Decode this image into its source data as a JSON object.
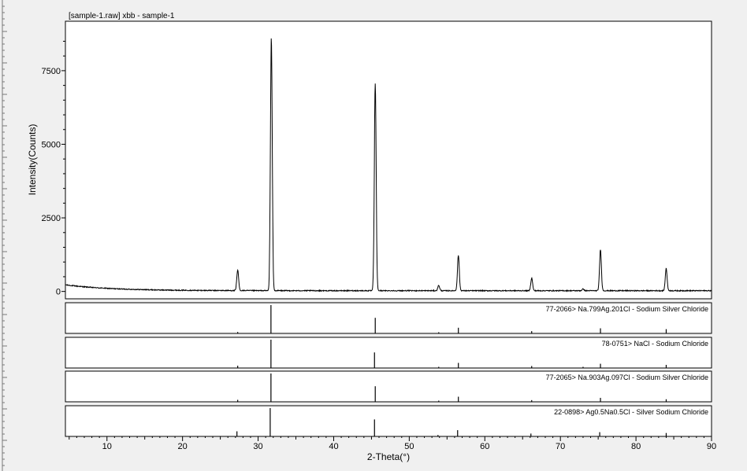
{
  "chart_data": {
    "type": "line",
    "title": "[sample-1.raw] xbb - sample-1",
    "xlabel": "2-Theta(°)",
    "ylabel": "Intensity(Counts)",
    "xlim": [
      4.5,
      90
    ],
    "ylim": [
      -250,
      9180
    ],
    "x_ticks": [
      10,
      20,
      30,
      40,
      50,
      60,
      70,
      80,
      90
    ],
    "y_ticks": [
      0,
      2500,
      5000,
      7500
    ],
    "grid": false,
    "background": 200,
    "peaks": [
      {
        "x": 27.3,
        "y": 700
      },
      {
        "x": 31.75,
        "y": 8600
      },
      {
        "x": 45.5,
        "y": 7050
      },
      {
        "x": 53.9,
        "y": 180
      },
      {
        "x": 56.5,
        "y": 1200
      },
      {
        "x": 66.2,
        "y": 430
      },
      {
        "x": 73.0,
        "y": 60
      },
      {
        "x": 75.3,
        "y": 1400
      },
      {
        "x": 84.0,
        "y": 760
      }
    ],
    "reference_patterns": [
      {
        "label": "77-2066> Na.799Ag.201Cl - Sodium Silver Chloride",
        "lines": [
          {
            "x": 27.3,
            "rel": 0.05
          },
          {
            "x": 31.7,
            "rel": 1.0
          },
          {
            "x": 45.5,
            "rel": 0.55
          },
          {
            "x": 53.9,
            "rel": 0.02
          },
          {
            "x": 56.5,
            "rel": 0.2
          },
          {
            "x": 66.2,
            "rel": 0.08
          },
          {
            "x": 75.3,
            "rel": 0.18
          },
          {
            "x": 84.0,
            "rel": 0.15
          }
        ]
      },
      {
        "label": "78-0751> NaCl - Sodium Chloride",
        "lines": [
          {
            "x": 27.3,
            "rel": 0.08
          },
          {
            "x": 31.7,
            "rel": 1.0
          },
          {
            "x": 45.4,
            "rel": 0.55
          },
          {
            "x": 53.9,
            "rel": 0.03
          },
          {
            "x": 56.5,
            "rel": 0.18
          },
          {
            "x": 66.2,
            "rel": 0.07
          },
          {
            "x": 73.0,
            "rel": 0.02
          },
          {
            "x": 75.3,
            "rel": 0.15
          },
          {
            "x": 84.0,
            "rel": 0.11
          }
        ]
      },
      {
        "label": "77-2065> Na.903Ag.097Cl - Sodium Silver Chloride",
        "lines": [
          {
            "x": 27.3,
            "rel": 0.07
          },
          {
            "x": 31.7,
            "rel": 1.0
          },
          {
            "x": 45.5,
            "rel": 0.55
          },
          {
            "x": 53.9,
            "rel": 0.03
          },
          {
            "x": 56.5,
            "rel": 0.18
          },
          {
            "x": 66.2,
            "rel": 0.06
          },
          {
            "x": 75.3,
            "rel": 0.14
          },
          {
            "x": 84.0,
            "rel": 0.09
          }
        ]
      },
      {
        "label": "22-0898> Ag0.5Na0.5Cl - Silver Sodium Chloride",
        "lines": [
          {
            "x": 27.2,
            "rel": 0.18
          },
          {
            "x": 31.6,
            "rel": 1.0
          },
          {
            "x": 45.4,
            "rel": 0.6
          },
          {
            "x": 53.8,
            "rel": 0.05
          },
          {
            "x": 56.4,
            "rel": 0.22
          },
          {
            "x": 66.1,
            "rel": 0.1
          },
          {
            "x": 75.2,
            "rel": 0.15
          },
          {
            "x": 84.0,
            "rel": 0.12
          }
        ]
      }
    ]
  }
}
